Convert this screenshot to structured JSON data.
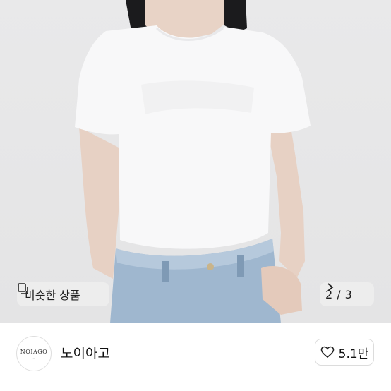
{
  "product": {
    "similar_label": "비슷한 상품",
    "similar_icon": "similar-items-icon",
    "image_index": "2",
    "image_total": "3",
    "chevron_icon": "chevron-right-icon"
  },
  "shop": {
    "logo_text": "NOIAGO",
    "name": "노이아고",
    "like_icon": "heart-icon",
    "like_count": "5.1만"
  }
}
